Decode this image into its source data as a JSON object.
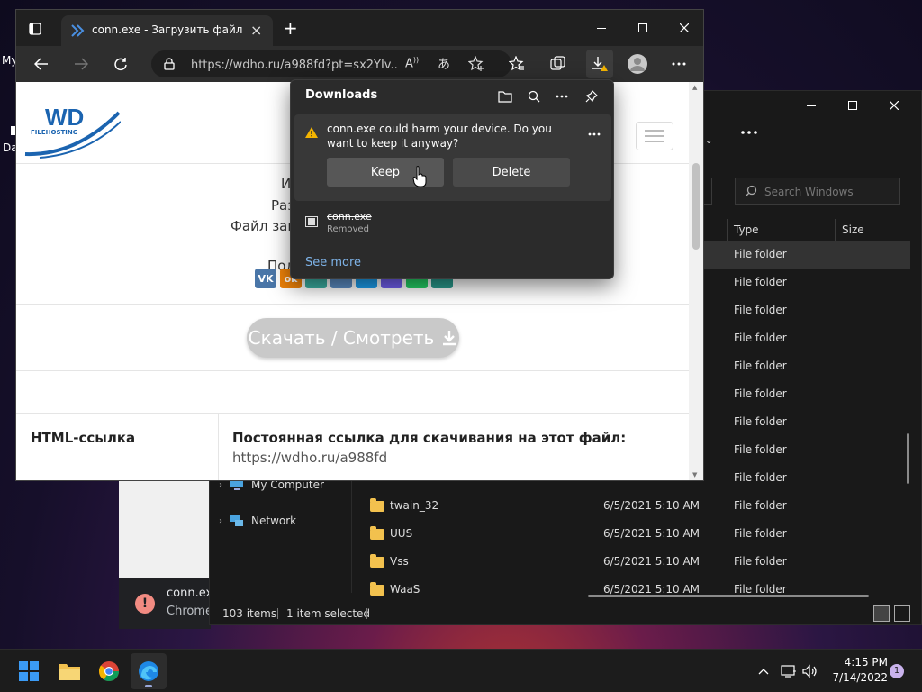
{
  "desktop": {
    "label_my": "My",
    "label_da": "Da"
  },
  "chrome_bg": {
    "notification_line1": "conn.exe",
    "notification_line2": "Chrome"
  },
  "explorer": {
    "search_placeholder": "Search Windows",
    "columns": {
      "type": "Type",
      "size": "Size"
    },
    "nav": [
      {
        "label": "My Computer"
      },
      {
        "label": "Network"
      }
    ],
    "rows": [
      {
        "name": "",
        "date": "",
        "type": "File folder",
        "selected": true
      },
      {
        "name": "",
        "date": "",
        "type": "File folder"
      },
      {
        "name": "",
        "date": "",
        "type": "File folder"
      },
      {
        "name": "",
        "date": "",
        "type": "File folder"
      },
      {
        "name": "",
        "date": "",
        "type": "File folder"
      },
      {
        "name": "",
        "date": "",
        "type": "File folder"
      },
      {
        "name": "",
        "date": "",
        "type": "File folder"
      },
      {
        "name": "",
        "date": "",
        "type": "File folder"
      },
      {
        "name": "",
        "date": "",
        "type": "File folder"
      },
      {
        "name": "twain_32",
        "date": "6/5/2021 5:10 AM",
        "type": "File folder"
      },
      {
        "name": "UUS",
        "date": "6/5/2021 5:10 AM",
        "type": "File folder"
      },
      {
        "name": "Vss",
        "date": "6/5/2021 5:10 AM",
        "type": "File folder"
      },
      {
        "name": "WaaS",
        "date": "6/5/2021 5:10 AM",
        "type": "File folder"
      }
    ],
    "status": {
      "items": "103 items",
      "selected": "1 item selected"
    }
  },
  "edge": {
    "tab_title": "conn.exe - Загрузить файл или с",
    "url": "https://wdho.ru/a988fd?pt=sx2YIv...",
    "page": {
      "logo_text": "WD",
      "logo_sub": "FILEHOSTING",
      "info_lines": [
        "И",
        "Раз",
        "Файл заг"
      ],
      "share_label": "Под",
      "download_button": "Скачать / Смотреть",
      "html_link_label": "HTML-ссылка",
      "permalink_title": "Постоянная ссылка для скачивания на этот файл:",
      "permalink_url": "https://wdho.ru/a988fd"
    }
  },
  "downloads": {
    "title": "Downloads",
    "warning": "conn.exe could harm your device. Do you want to keep it anyway?",
    "keep": "Keep",
    "delete": "Delete",
    "item_name": "conn.exe",
    "item_status": "Removed",
    "see_more": "See more"
  },
  "taskbar": {
    "time": "4:15 PM",
    "date": "7/14/2022",
    "notifications": "1"
  },
  "colors": {
    "accent": "#0078d4",
    "warning": "#f4b400",
    "link": "#7eb3e8"
  }
}
